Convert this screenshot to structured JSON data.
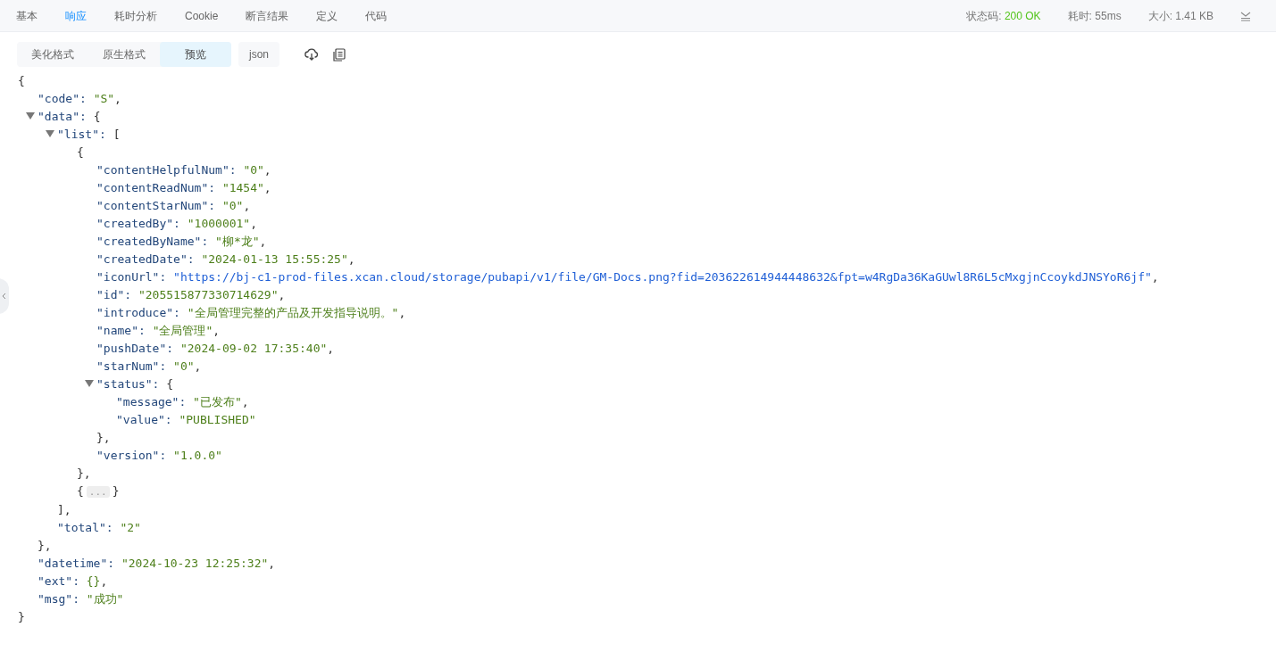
{
  "tabs": [
    {
      "label": "基本",
      "selected": false
    },
    {
      "label": "响应",
      "selected": true
    },
    {
      "label": "耗时分析",
      "selected": false
    },
    {
      "label": "Cookie",
      "selected": false
    },
    {
      "label": "断言结果",
      "selected": false
    },
    {
      "label": "定义",
      "selected": false
    },
    {
      "label": "代码",
      "selected": false
    }
  ],
  "stats": [
    {
      "label": "状态码: ",
      "value": "200 OK",
      "kind": "success"
    },
    {
      "label": "耗时: ",
      "value": "55ms",
      "kind": "plain"
    },
    {
      "label": "大小: ",
      "value": "1.41 KB",
      "kind": "plain"
    }
  ],
  "format_tabs": [
    {
      "label": "美化格式",
      "selected": false
    },
    {
      "label": "原生格式",
      "selected": false
    },
    {
      "label": "预览",
      "selected": true
    }
  ],
  "type_button": "json",
  "json_tree": {
    "open": "{",
    "close": "}",
    "children": [
      {
        "kind": "string",
        "key": "\"code\": ",
        "value": "\"S\"",
        "end": ","
      },
      {
        "kind": "object",
        "key": "\"data\": ",
        "open": "{",
        "close": "},",
        "expanded": true,
        "children": [
          {
            "kind": "object",
            "key": "\"list\": ",
            "open": "[",
            "close": "],",
            "expanded": true,
            "children": [
              {
                "kind": "object",
                "open": "{",
                "close": "},",
                "children": [
                  {
                    "kind": "string",
                    "key": "\"contentHelpfulNum\": ",
                    "value": "\"0\"",
                    "end": ","
                  },
                  {
                    "kind": "string",
                    "key": "\"contentReadNum\": ",
                    "value": "\"1454\"",
                    "end": ","
                  },
                  {
                    "kind": "string",
                    "key": "\"contentStarNum\": ",
                    "value": "\"0\"",
                    "end": ","
                  },
                  {
                    "kind": "string",
                    "key": "\"createdBy\": ",
                    "value": "\"1000001\"",
                    "end": ","
                  },
                  {
                    "kind": "string",
                    "key": "\"createdByName\": ",
                    "value": "\"柳*龙\"",
                    "end": ","
                  },
                  {
                    "kind": "string",
                    "key": "\"createdDate\": ",
                    "value": "\"2024-01-13 15:55:25\"",
                    "end": ","
                  },
                  {
                    "kind": "link",
                    "key": "\"iconUrl\": ",
                    "value": "\"https://bj-c1-prod-files.xcan.cloud/storage/pubapi/v1/file/GM-Docs.png?fid=203622614944448632&fpt=w4RgDa36KaGUwl8R6L5cMxgjnCcoykdJNSYoR6jf\"",
                    "end": ","
                  },
                  {
                    "kind": "string",
                    "key": "\"id\": ",
                    "value": "\"205515877330714629\"",
                    "end": ","
                  },
                  {
                    "kind": "string",
                    "key": "\"introduce\": ",
                    "value": "\"全局管理完整的产品及开发指导说明。\"",
                    "end": ","
                  },
                  {
                    "kind": "string",
                    "key": "\"name\": ",
                    "value": "\"全局管理\"",
                    "end": ","
                  },
                  {
                    "kind": "string",
                    "key": "\"pushDate\": ",
                    "value": "\"2024-09-02 17:35:40\"",
                    "end": ","
                  },
                  {
                    "kind": "string",
                    "key": "\"starNum\": ",
                    "value": "\"0\"",
                    "end": ","
                  },
                  {
                    "kind": "object",
                    "key": "\"status\": ",
                    "open": "{",
                    "close": "},",
                    "expanded": true,
                    "children": [
                      {
                        "kind": "string",
                        "key": "\"message\": ",
                        "value": "\"已发布\"",
                        "end": ","
                      },
                      {
                        "kind": "string",
                        "key": "\"value\": ",
                        "value": "\"PUBLISHED\""
                      }
                    ]
                  },
                  {
                    "kind": "string",
                    "key": "\"version\": ",
                    "value": "\"1.0.0\""
                  }
                ]
              },
              {
                "kind": "collapsed",
                "open": "{",
                "ellipsis": "...",
                "close": "}"
              }
            ]
          },
          {
            "kind": "string",
            "key": "\"total\": ",
            "value": "\"2\""
          }
        ]
      },
      {
        "kind": "string",
        "key": "\"datetime\": ",
        "value": "\"2024-10-23 12:25:32\"",
        "end": ","
      },
      {
        "kind": "string",
        "key": "\"ext\": ",
        "value": "{}",
        "end": ","
      },
      {
        "kind": "string",
        "key": "\"msg\": ",
        "value": "\"成功\""
      }
    ]
  }
}
